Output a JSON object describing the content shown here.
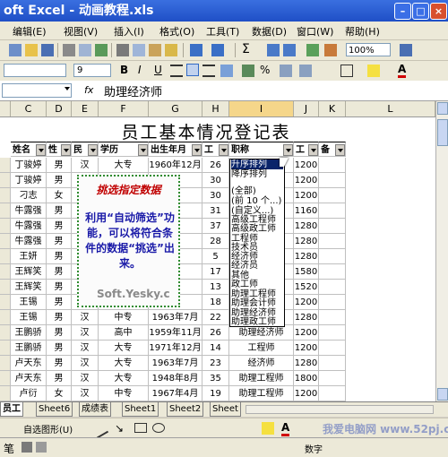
{
  "window": {
    "title": "oft Excel - 动画教程.xls"
  },
  "menu": [
    "编辑(E)",
    "视图(V)",
    "插入(I)",
    "格式(O)",
    "工具(T)",
    "数据(D)",
    "窗口(W)",
    "帮助(H)"
  ],
  "toolbar": {
    "zoom": "100%",
    "font_size": "9"
  },
  "formula_bar": {
    "name_box": "",
    "fx": "fx",
    "value": "助理经济师"
  },
  "columns": [
    "C",
    "D",
    "E",
    "F",
    "G",
    "H",
    "I",
    "J",
    "K",
    "L"
  ],
  "sheet_title": "员工基本情况登记表",
  "headers": [
    "姓名",
    "性",
    "民",
    "学历",
    "出生年月",
    "工",
    "职称",
    "工",
    "备"
  ],
  "rows": [
    [
      "丁骏婷",
      "男",
      "汉",
      "大专",
      "1960年12月",
      "26",
      "",
      "1200",
      ""
    ],
    [
      "丁骏婷",
      "男",
      "",
      "",
      "",
      "30",
      "",
      "1200",
      ""
    ],
    [
      "刁志",
      "女",
      "",
      "",
      "",
      "30",
      "",
      "1200",
      ""
    ],
    [
      "牛露强",
      "男",
      "",
      "",
      "",
      "31",
      "",
      "1160",
      ""
    ],
    [
      "牛露强",
      "男",
      "",
      "",
      "",
      "37",
      "",
      "1280",
      ""
    ],
    [
      "牛露强",
      "男",
      "",
      "",
      "",
      "28",
      "",
      "1280",
      ""
    ],
    [
      "王妍",
      "男",
      "",
      "",
      "",
      "5",
      "",
      "1280",
      ""
    ],
    [
      "王辉笑",
      "男",
      "",
      "",
      "",
      "17",
      "",
      "1580",
      ""
    ],
    [
      "王辉笑",
      "男",
      "",
      "",
      "",
      "13",
      "",
      "1520",
      ""
    ],
    [
      "王锡",
      "男",
      "",
      "",
      "",
      "18",
      "",
      "1200",
      ""
    ],
    [
      "王锡",
      "男",
      "汉",
      "中专",
      "1963年7月",
      "22",
      "",
      "1280",
      ""
    ],
    [
      "王鹏骄",
      "男",
      "汉",
      "高中",
      "1959年11月",
      "26",
      "助理经济师",
      "1200",
      ""
    ],
    [
      "王鹏骄",
      "男",
      "汉",
      "大专",
      "1971年12月",
      "14",
      "工程师",
      "1200",
      ""
    ],
    [
      "卢天东",
      "男",
      "汉",
      "大专",
      "1963年7月",
      "23",
      "经济师",
      "1280",
      ""
    ],
    [
      "卢天东",
      "男",
      "汉",
      "大专",
      "1948年8月",
      "35",
      "助理工程师",
      "1800",
      ""
    ],
    [
      "卢衍",
      "女",
      "汉",
      "中专",
      "1967年4月",
      "19",
      "助理工程师",
      "1200",
      ""
    ],
    [
      "",
      "",
      "",
      "",
      "",
      "",
      "",
      "",
      ""
    ]
  ],
  "note": {
    "heading": "挑选指定数据",
    "body": "利用“自动筛选”功能，可以将符合条件的数据“挑选”出来。",
    "watermark": "Soft.Yesky.c"
  },
  "dropdown": {
    "items": [
      "升序排列",
      "降序排列",
      "(全部)",
      "(前 10 个...)",
      "(自定义...)",
      "高级工程师",
      "高级政工师",
      "工程师",
      "技术员",
      "经济师",
      "经济员",
      "其他",
      "政工师",
      "助理工程师",
      "助理会计师",
      "助理经济师",
      "助理政工师"
    ],
    "selected_index": 0
  },
  "sheet_tabs": [
    "员工",
    "Sheet6",
    "成绩表",
    "Sheet1",
    "Sheet2",
    "Sheet"
  ],
  "draw_bar": {
    "label": "自选图形(U)"
  },
  "status": {
    "left": "笔",
    "mode": "数字"
  },
  "brand_watermark": "我爱电脑网 www.52pj.com",
  "colors": {
    "title_bar": "#245edc",
    "note_border": "#2f8b2f",
    "note_heading": "#c00000",
    "note_body": "#1a1aa8",
    "selection": "#0a246a"
  }
}
